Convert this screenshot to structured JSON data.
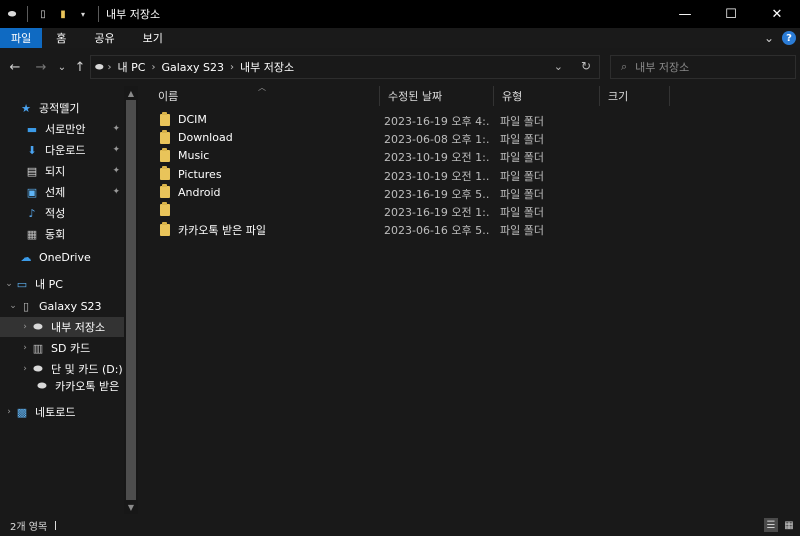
{
  "titlebar": {
    "title": "내부 저장소",
    "qa_icons": [
      "drive-icon",
      "document-icon",
      "folder-icon",
      "dropdown-icon"
    ],
    "minimize": "—",
    "maximize": "☐",
    "close": "✕"
  },
  "ribbon": {
    "tabs": [
      "파일",
      "홈",
      "공유",
      "보기"
    ],
    "expand": "⌄",
    "help": "?"
  },
  "address": {
    "back": "←",
    "forward": "→",
    "recent": "⌄",
    "up": "↑",
    "crumbs": [
      "내 PC",
      "Galaxy S23",
      "내부 저장소"
    ],
    "sep": "›",
    "dropdown": "⌄",
    "refresh": "↻"
  },
  "search": {
    "placeholder": "내부 저장소"
  },
  "nav": {
    "items": [
      {
        "label": "공적뗄기",
        "icon": "star-icon",
        "glyph": "★",
        "color": "#4aa3f0",
        "exp": "",
        "pinned": false,
        "selected": false
      },
      {
        "label": "서로만안",
        "icon": "desktop-icon",
        "glyph": "▬",
        "color": "#3b9be8",
        "exp": "",
        "pinned": true,
        "selected": false
      },
      {
        "label": "다운로드",
        "icon": "download-icon",
        "glyph": "⬇",
        "color": "#4aa3f0",
        "exp": "",
        "pinned": true,
        "selected": false
      },
      {
        "label": "되지",
        "icon": "document-icon",
        "glyph": "▤",
        "color": "#d9d9d9",
        "exp": "",
        "pinned": true,
        "selected": false
      },
      {
        "label": "선제",
        "icon": "pictures-icon",
        "glyph": "▣",
        "color": "#5fb4f5",
        "exp": "",
        "pinned": true,
        "selected": false
      },
      {
        "label": "적성",
        "icon": "music-icon",
        "glyph": "♪",
        "color": "#5aa8ec",
        "exp": "",
        "pinned": false,
        "selected": false
      },
      {
        "label": "동회",
        "icon": "video-icon",
        "glyph": "▦",
        "color": "#bdbdbd",
        "exp": "",
        "pinned": false,
        "selected": false
      },
      {
        "label": "OneDrive",
        "icon": "cloud-icon",
        "glyph": "☁",
        "color": "#3b9be8",
        "exp": "",
        "pinned": false,
        "selected": false
      },
      {
        "label": "내 PC",
        "icon": "computer-icon",
        "glyph": "▭",
        "color": "#5fb4f5",
        "exp": "⌄",
        "pinned": false,
        "selected": false
      },
      {
        "label": "Galaxy S23",
        "icon": "phone-icon",
        "glyph": "▯",
        "color": "#bdbdbd",
        "exp": "⌄",
        "pinned": false,
        "selected": false
      },
      {
        "label": "내부 저장소",
        "icon": "drive-icon",
        "glyph": "⬬",
        "color": "#d9d9d9",
        "exp": "›",
        "pinned": false,
        "selected": true
      },
      {
        "label": "SD 카드",
        "icon": "sdcard-icon",
        "glyph": "▥",
        "color": "#bdbdbd",
        "exp": "›",
        "pinned": false,
        "selected": false
      },
      {
        "label": "단 및 카드 (D:)",
        "icon": "drive-icon",
        "glyph": "⬬",
        "color": "#d9d9d9",
        "exp": "›",
        "pinned": false,
        "selected": false
      },
      {
        "label": "카카오톡 받은",
        "icon": "shortcut-drive-icon",
        "glyph": "⬬",
        "color": "#d9d9d9",
        "exp": "",
        "pinned": false,
        "selected": false
      },
      {
        "label": "네토로드",
        "icon": "network-icon",
        "glyph": "▩",
        "color": "#5fb4f5",
        "exp": "›",
        "pinned": false,
        "selected": false
      }
    ],
    "pin_glyph": "📌"
  },
  "columns": {
    "name": "이름",
    "date": "수정된 날짜",
    "type": "유형",
    "size": "크기"
  },
  "files": [
    {
      "name": "DCIM",
      "date": "2023-16-19 오후 4:…",
      "type": "파일 폴더"
    },
    {
      "name": "Download",
      "date": "2023-06-08 오후 1:…",
      "type": "파일 폴더"
    },
    {
      "name": "Music",
      "date": "2023-10-19 오전 1:…",
      "type": "파일 폴더"
    },
    {
      "name": "Pictures",
      "date": "2023-10-19 오전 1…",
      "type": "파일 폴더"
    },
    {
      "name": "Android",
      "date": "2023-16-19 오후 5…",
      "type": "파일 폴더"
    },
    {
      "name": "",
      "date": "2023-16-19 오전 1:…",
      "type": "파일 폴더"
    },
    {
      "name": "카카오톡 받은 파일",
      "date": "2023-06-16 오후 5…",
      "type": "파일 폴더"
    }
  ],
  "status": {
    "text": "2개 영목"
  },
  "viewbuttons": {
    "details": "☰",
    "tiles": "▦"
  }
}
